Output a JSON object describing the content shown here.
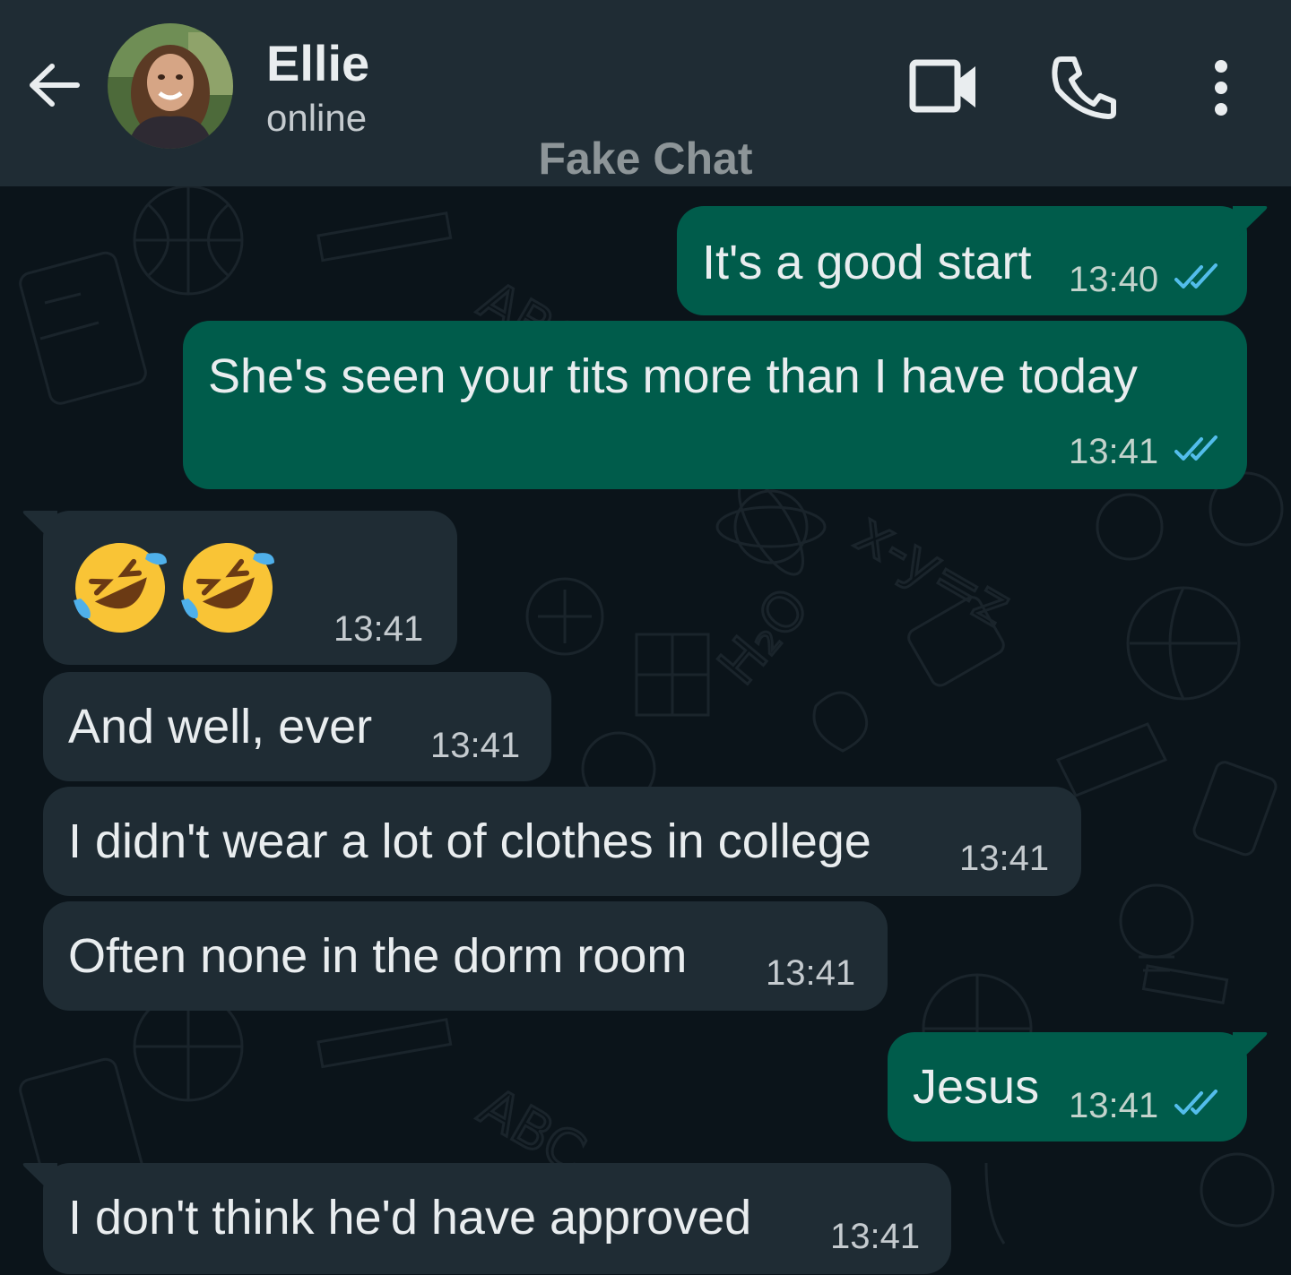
{
  "header": {
    "contact_name": "Ellie",
    "contact_status": "online",
    "watermark": "Fake Chat"
  },
  "colors": {
    "header_bg": "#1f2c34",
    "chat_bg": "#0b141a",
    "outgoing_bubble": "#005c4b",
    "incoming_bubble": "#1f2c34",
    "read_ticks": "#53bdeb"
  },
  "messages": [
    {
      "direction": "outgoing",
      "text": "It's a good start",
      "time": "13:40",
      "status": "read"
    },
    {
      "direction": "outgoing",
      "text": "She's seen your tits more than I have today",
      "time": "13:41",
      "status": "read"
    },
    {
      "direction": "incoming",
      "text": "🤣🤣",
      "time": "13:41"
    },
    {
      "direction": "incoming",
      "text": "And well, ever",
      "time": "13:41"
    },
    {
      "direction": "incoming",
      "text": "I didn't wear a lot of clothes in college",
      "time": "13:41"
    },
    {
      "direction": "incoming",
      "text": "Often none in the dorm room",
      "time": "13:41"
    },
    {
      "direction": "outgoing",
      "text": "Jesus",
      "time": "13:41",
      "status": "read"
    },
    {
      "direction": "incoming",
      "text": "I don't think he'd have approved",
      "time": "13:41"
    }
  ]
}
